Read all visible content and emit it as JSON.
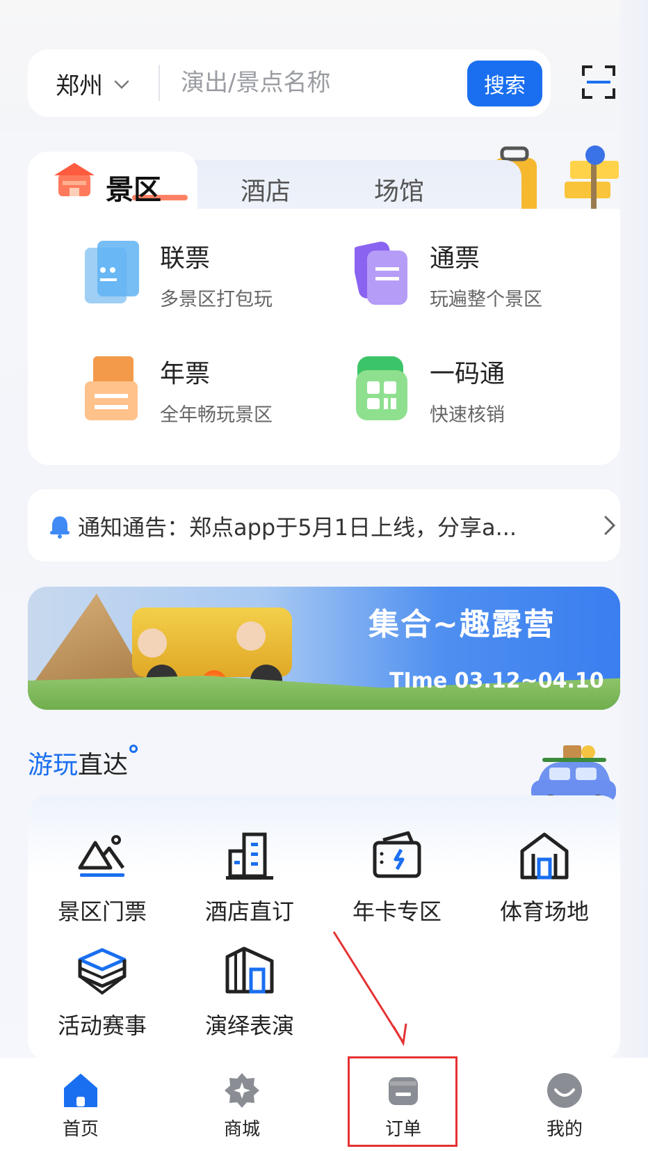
{
  "search": {
    "city": "郑州",
    "placeholder": "演出/景点名称",
    "button_label": "搜索"
  },
  "tabs": [
    {
      "label": "景区",
      "active": true
    },
    {
      "label": "酒店",
      "active": false
    },
    {
      "label": "场馆",
      "active": false
    }
  ],
  "tickets": [
    {
      "title": "联票",
      "subtitle": "多景区打包玩",
      "icon": "combo-ticket-icon"
    },
    {
      "title": "通票",
      "subtitle": "玩遍整个景区",
      "icon": "pass-ticket-icon"
    },
    {
      "title": "年票",
      "subtitle": "全年畅玩景区",
      "icon": "annual-ticket-icon"
    },
    {
      "title": "一码通",
      "subtitle": "快速核销",
      "icon": "qr-code-icon"
    }
  ],
  "notice": {
    "text": "通知通告：郑点app于5月1日上线，分享a..."
  },
  "banner": {
    "title": "集合~趣露营",
    "time": "TIme 03.12~04.10"
  },
  "section": {
    "title_blue": "游玩",
    "title_rest": "直达"
  },
  "quick_links": [
    {
      "label": "景区门票",
      "icon": "mountain-icon"
    },
    {
      "label": "酒店直订",
      "icon": "building-icon"
    },
    {
      "label": "年卡专区",
      "icon": "card-icon"
    },
    {
      "label": "体育场地",
      "icon": "stadium-icon"
    },
    {
      "label": "活动赛事",
      "icon": "boxing-ring-icon"
    },
    {
      "label": "演绎表演",
      "icon": "theater-icon"
    }
  ],
  "bottom_nav": [
    {
      "label": "首页",
      "active": true
    },
    {
      "label": "商城",
      "active": false
    },
    {
      "label": "订单",
      "active": false
    },
    {
      "label": "我的",
      "active": false
    }
  ],
  "colors": {
    "accent": "#1a6ff0",
    "annotation": "#e53232"
  }
}
